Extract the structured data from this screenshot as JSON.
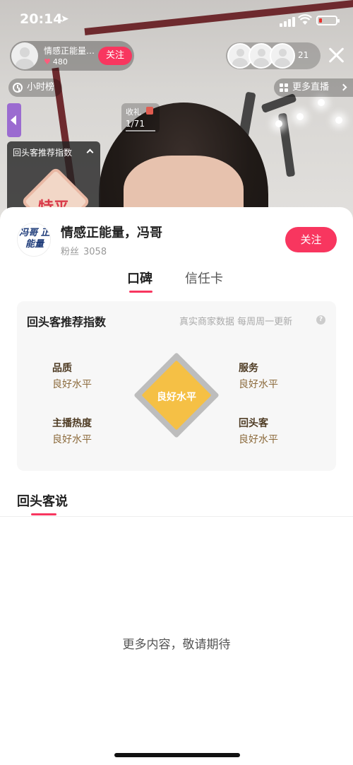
{
  "status_bar": {
    "time": "20:14"
  },
  "live": {
    "host_name": "情感正能量…",
    "likes": "480",
    "follow_label": "关注",
    "viewer_count": "21",
    "hour_rank_label": "小时榜",
    "more_live_label": "更多直播",
    "gift_label": "收礼",
    "gift_value": "1/71",
    "mini_card_title": "回头客推荐指数",
    "mini_badge_text": "特平"
  },
  "sheet": {
    "shop_logo_text": "冯哥 正能量",
    "shop_name": "情感正能量，冯哥",
    "fans_label": "粉丝",
    "fans_count": "3058",
    "follow_label": "关注",
    "tabs": [
      {
        "label": "口碑",
        "active": true
      },
      {
        "label": "信任卡",
        "active": false
      }
    ],
    "index_card": {
      "title": "回头客推荐指数",
      "note": "真实商家数据 每周周一更新",
      "center_level": "良好水平",
      "metrics": [
        {
          "name": "品质",
          "level": "良好水平"
        },
        {
          "name": "服务",
          "level": "良好水平"
        },
        {
          "name": "主播热度",
          "level": "良好水平"
        },
        {
          "name": "回头客",
          "level": "良好水平"
        }
      ]
    },
    "section_title": "回头客说",
    "placeholder": "更多内容，敬请期待"
  },
  "colors": {
    "accent": "#f8365f",
    "diamond": "#f5c045",
    "metric_name": "#4e3b23",
    "metric_level": "#8c6b3d"
  }
}
